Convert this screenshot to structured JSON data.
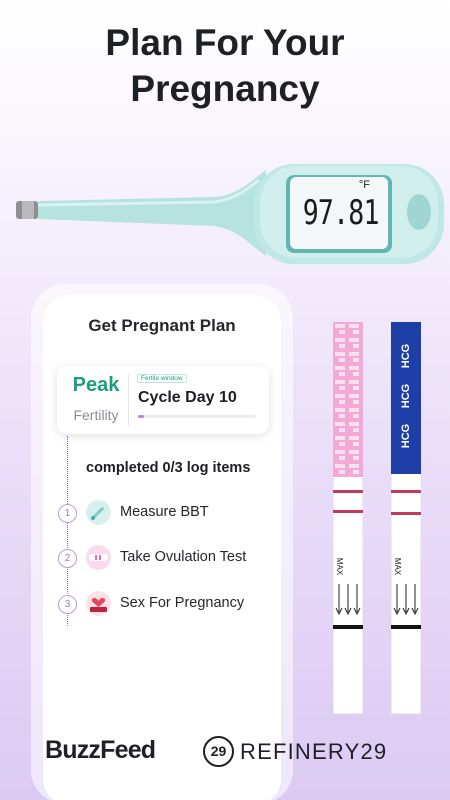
{
  "headline": {
    "line1": "Plan For Your",
    "line2": "Pregnancy"
  },
  "thermometer": {
    "reading": "97.81",
    "unit": "°F"
  },
  "plan": {
    "title": "Get Pregnant Plan",
    "status": {
      "level": "Peak",
      "level_label": "Fertility",
      "window_tag": "Fertile window",
      "cycle_day": "Cycle Day 10",
      "progress": 0.05
    },
    "completed": "completed 0/3 log items",
    "items": [
      {
        "num": "1",
        "label": "Measure BBT",
        "icon": "thermometer-icon"
      },
      {
        "num": "2",
        "label": "Take Ovulation Test",
        "icon": "ovulation-test-icon"
      },
      {
        "num": "3",
        "label": "Sex For Pregnancy",
        "icon": "heart-bed-icon"
      }
    ]
  },
  "test_strips": {
    "pink_strip_label": "MAX",
    "blue_strip_label": "HCG",
    "blue_strip_max": "MAX"
  },
  "brands": {
    "buzzfeed": "BuzzFeed",
    "refinery_logo": "29",
    "refinery": "REFINERY29"
  },
  "colors": {
    "peak_green": "#1a9e7d",
    "accent_purple": "#b08cea",
    "pink_strip": "#f2a9d6",
    "blue_strip": "#1e3fa8"
  }
}
